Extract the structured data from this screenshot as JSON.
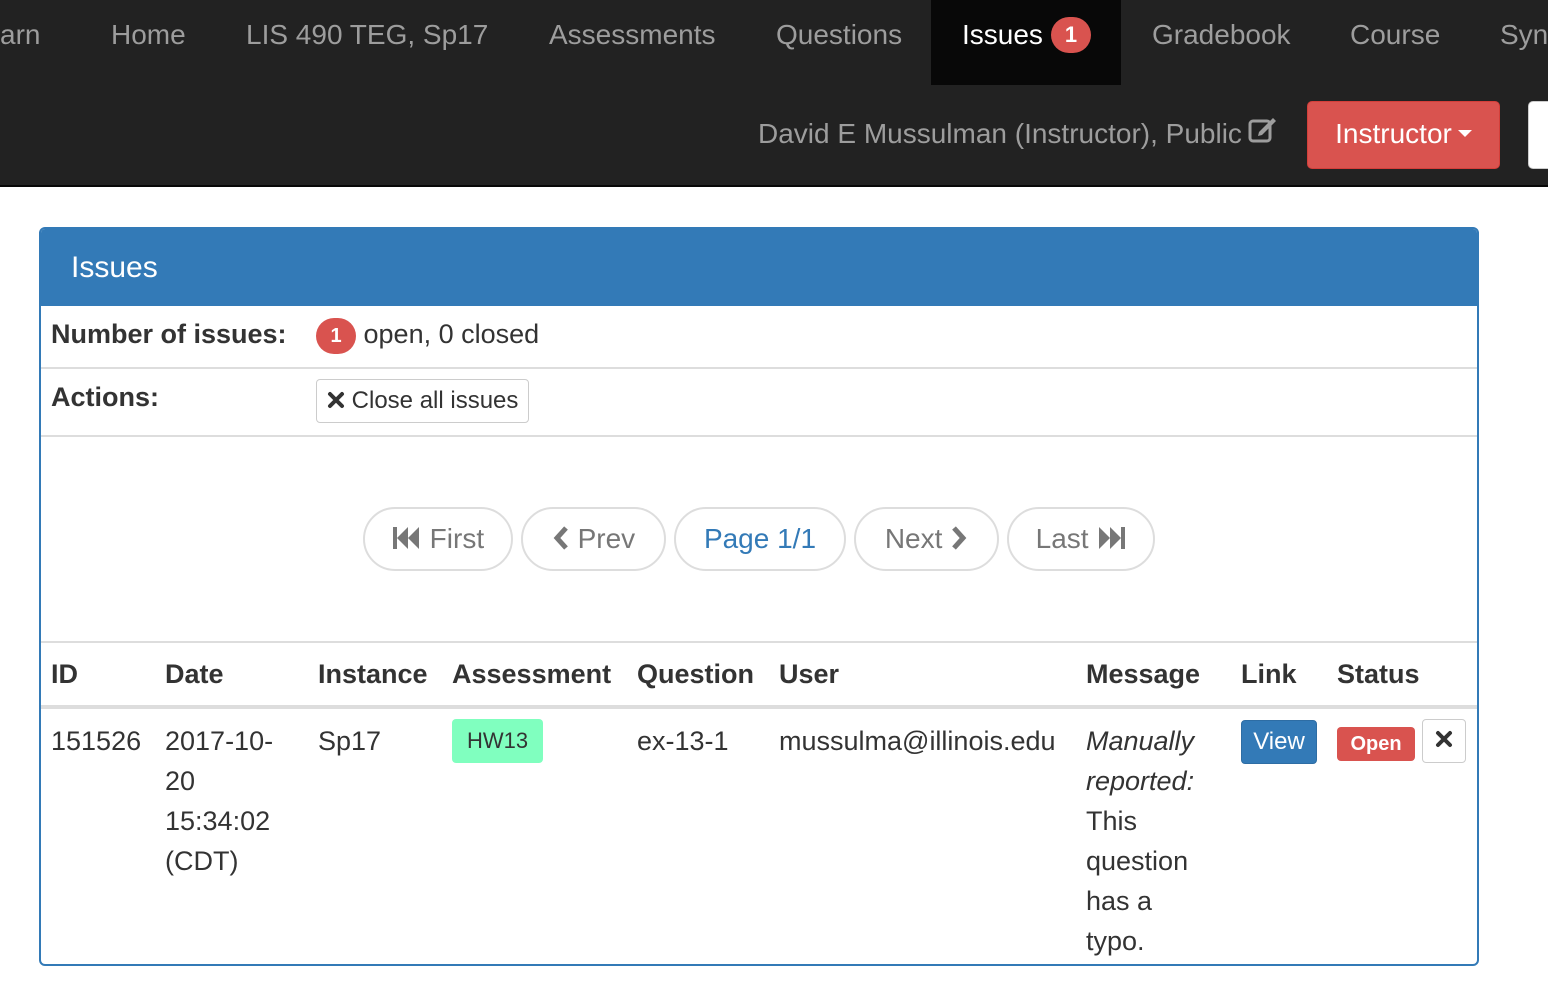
{
  "navbar": {
    "brand_fragment": "arn",
    "items": [
      {
        "label": "Home"
      },
      {
        "label": "LIS 490 TEG, Sp17"
      },
      {
        "label": "Assessments"
      },
      {
        "label": "Questions"
      },
      {
        "label": "Issues",
        "badge": "1",
        "active": true
      },
      {
        "label": "Gradebook"
      },
      {
        "label": "Course"
      },
      {
        "label": "Syn"
      }
    ],
    "user_text": "David E Mussulman (Instructor), Public",
    "user_edit_icon": "edit-icon",
    "role_button": "Instructor"
  },
  "panel": {
    "title": "Issues",
    "count_label": "Number of issues:",
    "open_count": "1",
    "count_text": "open, 0 closed",
    "actions_label": "Actions:",
    "close_all_label": "Close all issues"
  },
  "pager": {
    "first": "First",
    "prev": "Prev",
    "page": "Page 1/1",
    "next": "Next",
    "last": "Last"
  },
  "table": {
    "headers": {
      "id": "ID",
      "date": "Date",
      "instance": "Instance",
      "assessment": "Assessment",
      "question": "Question",
      "user": "User",
      "message": "Message",
      "link": "Link",
      "status": "Status"
    },
    "rows": [
      {
        "id": "151526",
        "date_lines": [
          "2017-10-",
          "20",
          "15:34:02",
          "(CDT)"
        ],
        "instance": "Sp17",
        "assessment": "HW13",
        "question": "ex-13-1",
        "user": "mussulma@illinois.edu",
        "message_prefix_lines": [
          "Manually",
          "reported:"
        ],
        "message_lines": [
          "This",
          "question",
          "has a",
          "typo."
        ],
        "link_label": "View",
        "status": "Open"
      }
    ]
  },
  "colors": {
    "navbar_bg": "#222222",
    "active_bg": "#080808",
    "primary": "#337ab7",
    "danger": "#d9534f",
    "assessment_badge": "#80ffbf"
  }
}
